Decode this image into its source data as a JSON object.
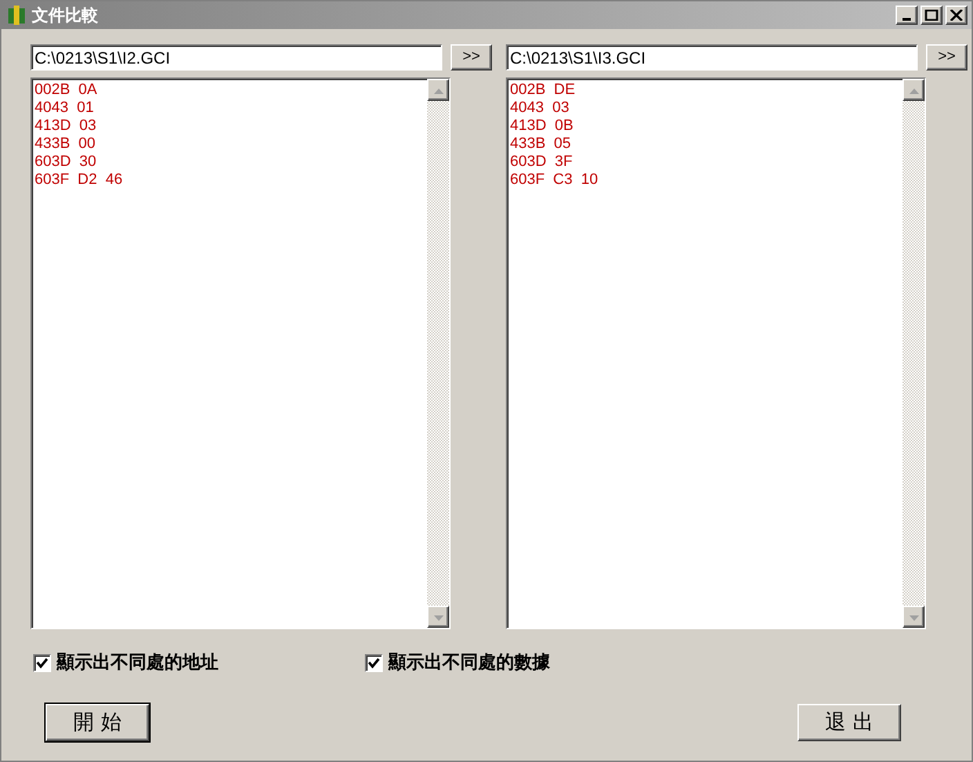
{
  "window": {
    "title": "文件比較"
  },
  "panes": [
    {
      "path": "C:\\0213\\S1\\I2.GCI",
      "browse": ">>",
      "lines": [
        "002B  0A",
        "4043  01",
        "413D  03",
        "433B  00",
        "603D  30",
        "603F  D2  46"
      ]
    },
    {
      "path": "C:\\0213\\S1\\I3.GCI",
      "browse": ">>",
      "lines": [
        "002B  DE",
        "4043  03",
        "413D  0B",
        "433B  05",
        "603D  3F",
        "603F  C3  10"
      ]
    }
  ],
  "options": [
    {
      "label": "顯示出不同處的地址",
      "checked": true
    },
    {
      "label": "顯示出不同處的數據",
      "checked": true
    }
  ],
  "buttons": [
    "開 始",
    "退 出"
  ]
}
